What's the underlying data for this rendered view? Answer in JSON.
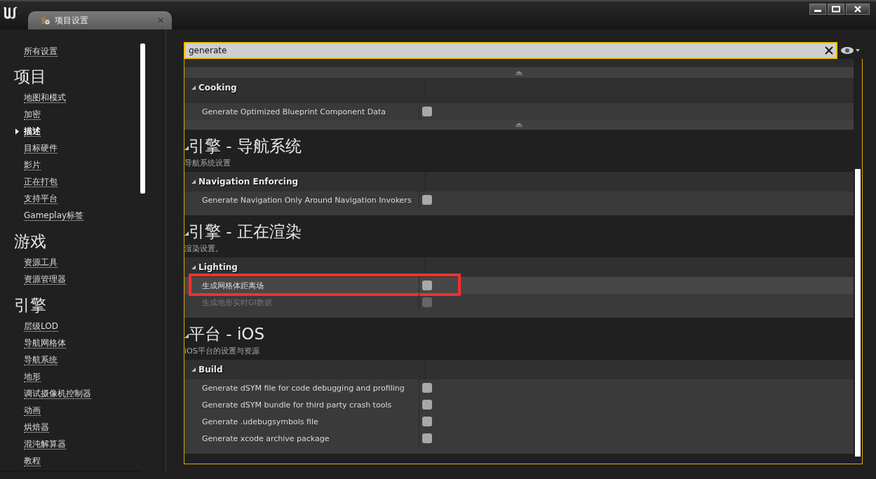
{
  "window": {
    "tab_title": "项目设置"
  },
  "sidebar": {
    "top_item": {
      "label": "所有设置",
      "selected": false
    },
    "groups": [
      {
        "title": "项目",
        "items": [
          {
            "label": "地图和模式",
            "selected": false
          },
          {
            "label": "加密",
            "selected": false
          },
          {
            "label": "描述",
            "selected": true
          },
          {
            "label": "目标硬件",
            "selected": false
          },
          {
            "label": "影片",
            "selected": false
          },
          {
            "label": "正在打包",
            "selected": false
          },
          {
            "label": "支持平台",
            "selected": false
          },
          {
            "label": "Gameplay标签",
            "selected": false
          }
        ]
      },
      {
        "title": "游戏",
        "items": [
          {
            "label": "资源工具",
            "selected": false
          },
          {
            "label": "资源管理器",
            "selected": false
          }
        ]
      },
      {
        "title": "引擎",
        "items": [
          {
            "label": "层级LOD",
            "selected": false
          },
          {
            "label": "导航网格体",
            "selected": false
          },
          {
            "label": "导航系统",
            "selected": false
          },
          {
            "label": "地形",
            "selected": false
          },
          {
            "label": "调试摄像机控制器",
            "selected": false
          },
          {
            "label": "动画",
            "selected": false
          },
          {
            "label": "烘焙器",
            "selected": false
          },
          {
            "label": "混沌解算器",
            "selected": false
          },
          {
            "label": "教程",
            "selected": false
          }
        ]
      }
    ]
  },
  "search": {
    "value": "generate"
  },
  "sections": [
    {
      "categories": [
        {
          "name": "Cooking",
          "rows": [
            {
              "label": "Generate Optimized Blueprint Component Data",
              "checked": false,
              "disabled": false,
              "annotated": false
            }
          ]
        }
      ]
    },
    {
      "title": "引擎 - 导航系统",
      "subtitle": "导航系统设置",
      "categories": [
        {
          "name": "Navigation Enforcing",
          "rows": [
            {
              "label": "Generate Navigation Only Around Navigation Invokers",
              "checked": false,
              "disabled": false,
              "annotated": false
            }
          ]
        }
      ]
    },
    {
      "title": "引擎 - 正在渲染",
      "subtitle": "渲染设置。",
      "categories": [
        {
          "name": "Lighting",
          "rows": [
            {
              "label": "生成网格体距离场",
              "checked": false,
              "disabled": false,
              "annotated": true
            },
            {
              "label": "生成地形实时GI数据",
              "checked": false,
              "disabled": true,
              "annotated": false
            }
          ]
        }
      ]
    },
    {
      "title": "平台 - iOS",
      "subtitle": "iOS平台的设置与资源",
      "categories": [
        {
          "name": "Build",
          "rows": [
            {
              "label": "Generate dSYM file for code debugging and profiling",
              "checked": false,
              "disabled": false,
              "annotated": false
            },
            {
              "label": "Generate dSYM bundle for third party crash tools",
              "checked": false,
              "disabled": false,
              "annotated": false
            },
            {
              "label": "Generate .udebugsymbols file",
              "checked": false,
              "disabled": false,
              "annotated": false
            },
            {
              "label": "Generate xcode archive package",
              "checked": false,
              "disabled": false,
              "annotated": false
            }
          ]
        }
      ]
    }
  ]
}
